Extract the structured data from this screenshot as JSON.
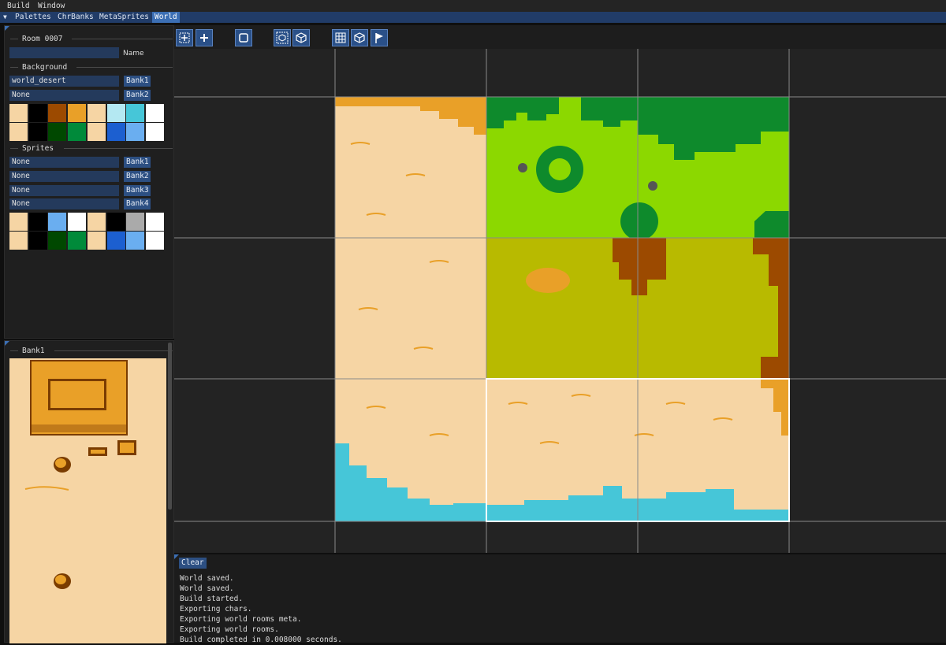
{
  "menu": [
    "Build",
    "Window"
  ],
  "tabs": [
    "Palettes",
    "ChrBanks",
    "MetaSprites",
    "World"
  ],
  "active_tab": "World",
  "room_panel": {
    "title": "Room 0007",
    "name_value": "",
    "name_label": "Name",
    "background_header": "Background",
    "bg_rows": [
      {
        "value": "world_desert",
        "bank": "Bank1"
      },
      {
        "value": "None",
        "bank": "Bank2"
      }
    ],
    "bg_palette": [
      [
        "#f6d5a4",
        "#000000",
        "#9c4a00",
        "#e9a028",
        "#f6d5a4",
        "#b4e8f2",
        "#46c6d8",
        "#ffffff"
      ],
      [
        "#f6d5a4",
        "#000000",
        "#004800",
        "#008a3a",
        "#f6d5a4",
        "#1c5fd0",
        "#6aaef0",
        "#ffffff"
      ]
    ],
    "sprites_header": "Sprites",
    "sprite_rows": [
      {
        "value": "None",
        "bank": "Bank1"
      },
      {
        "value": "None",
        "bank": "Bank2"
      },
      {
        "value": "None",
        "bank": "Bank3"
      },
      {
        "value": "None",
        "bank": "Bank4"
      }
    ],
    "sprite_palette": [
      [
        "#f6d5a4",
        "#000000",
        "#6aaef0",
        "#ffffff",
        "#f6d5a4",
        "#000000",
        "#aaaaaa",
        "#ffffff"
      ],
      [
        "#f6d5a4",
        "#000000",
        "#004800",
        "#008a3a",
        "#f6d5a4",
        "#1c5fd0",
        "#6aaef0",
        "#ffffff"
      ]
    ]
  },
  "bank_panel": {
    "title": "Bank1"
  },
  "toolbar": [
    "select-move-icon",
    "add-icon",
    "room-frame-icon",
    "object-cube-outline-icon",
    "object-cube-icon",
    "grid-icon",
    "cube-icon",
    "flag-icon"
  ],
  "console": {
    "clear_label": "Clear",
    "lines": [
      "World saved.",
      "World saved.",
      "Build started.",
      "Exporting chars.",
      "Exporting world rooms meta.",
      "Exporting world rooms.",
      "Build completed in 0.008000 seconds."
    ]
  },
  "colors": {
    "sand": "#f6d5a4",
    "dune": "#e9a028",
    "grass": "#8cd800",
    "swamp": "#b8ba00",
    "water": "#46c6d8",
    "forest": "#0e8a2c",
    "dirt": "#9c4a00",
    "accent": "#3c6fb4"
  }
}
